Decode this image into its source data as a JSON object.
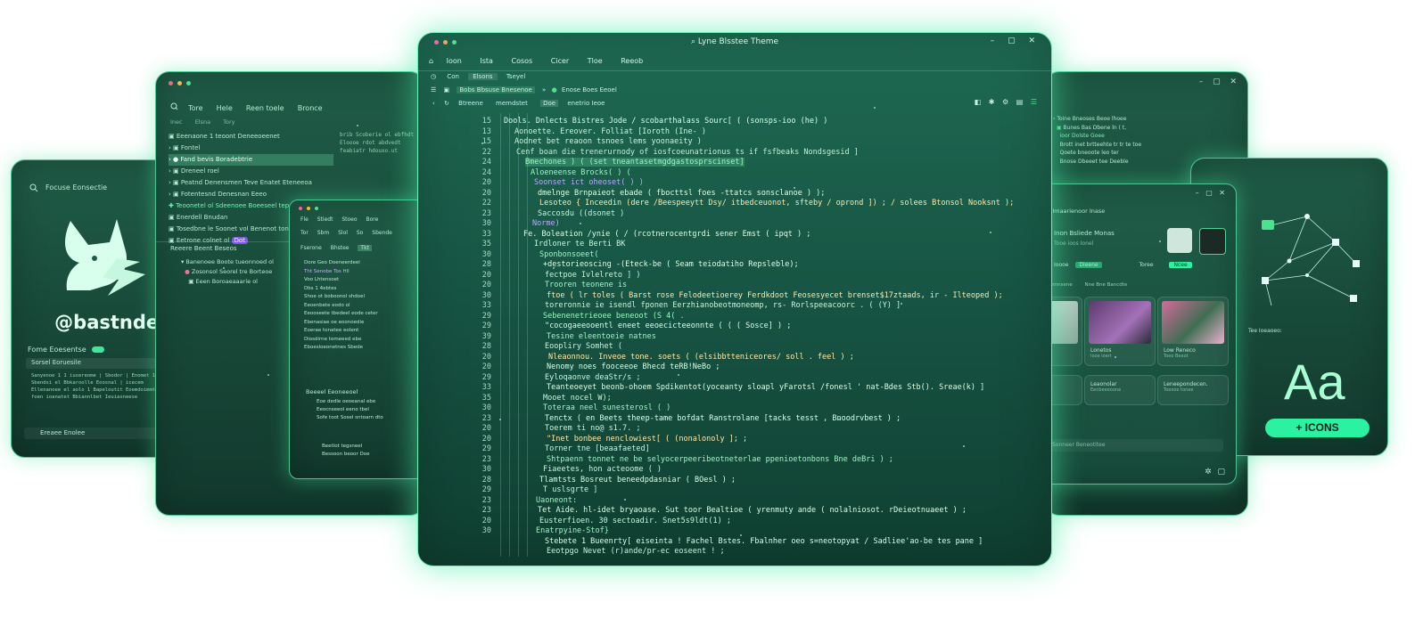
{
  "colors": {
    "accent": "#3ee89a",
    "panel": "#175443",
    "text": "#b8e9d3",
    "highlight": "#6fe8aa",
    "badge_bg": "#2af2a0"
  },
  "profile": {
    "search_label": "Focuse Eonsectie",
    "handle": "@bastndev",
    "setting_label": "Fome Eoesentse",
    "field_value": "Sorsel Eoruesile",
    "lines": [
      "Sanyenoe 1 1 iusereome | Sbodor | Enomet 1 EE ioonmd",
      "Sbendsi el Bbkaroolle Eoosnal | icecem",
      "Ellenanoee el aolo 1 Bapeloutit Eoemdoimmtgeesm",
      "foen ioanatet Bbiannlbet Ieuiasneese"
    ],
    "footer_label": "Ereaee Enolee"
  },
  "left_panel": {
    "menu": [
      "Tore",
      "Hele",
      "Reen toele",
      "Bronce"
    ],
    "tabs": [
      "Inec",
      "Elsna",
      "Tory"
    ],
    "tree": [
      "Eeenaone 1 teoont Deneeoeenet",
      "Fontel",
      "Fand bevis Boradebtrie",
      "Dreneel roel",
      "Peatnd Denensmen Teve Enatet Eteneeoa",
      "Fotentesnd Denesnan Eeeo",
      "Teoonetel ol Sdeenoee Boeeseel tep",
      "Enerdell Bnudan",
      "Tosedbne le Soonet vol Benenot tone",
      "Eetrone colnet ol"
    ],
    "tree_badge": "Dot",
    "section_label": "Reeere Beent Beseos",
    "sub_items": [
      "Banenoee Boote tueonnoed ol",
      "Zosonsol Seorel tre Borteoe",
      "Eeen Boroaeaaarie ol"
    ],
    "code_lines": [
      "brib Scoberie ol ebfhdt",
      "Eloooe rdot abdvedt",
      "feabiatr hdouxo.ut"
    ]
  },
  "mini_window": {
    "menu": [
      "Fle",
      "Stiedt",
      "Stoeo",
      "Bore"
    ],
    "toolbar": [
      "Tor",
      "Sbm",
      "Slol",
      "So",
      "Sbende"
    ],
    "tabs": [
      "Fserone",
      "Bhstee",
      "Tkt"
    ],
    "items": [
      "Dore Geo Doeneerdeel",
      "Tht Senobe Tos Hll",
      "Voo Lhtensoet",
      "Dbs 1 4ebtes",
      "Shoe ot boboonol shdoel",
      "Eeoenbete eodo ol",
      "Eeooseete tbedeel eode ceter",
      "Ebenasiae oe eoonoedie",
      "Eoerae tonatee eolent",
      "Diosdirne tomeeed ebe",
      "Eboesloeonetnes Sbede"
    ],
    "section_label": "Beeeel Eeoneeoel",
    "sub_items": [
      "Eoe dedle oeoeanal ebe",
      "Eeocnseeol eeno tbel",
      "Sofe toot Sosel sntoarn dto"
    ],
    "footer_items": [
      "Beetlot tegsneel",
      "Bessoon beoor Doe"
    ]
  },
  "main_window": {
    "title": "Lyne Blsstee Theme",
    "menu": [
      "Ioon",
      "Ista",
      "Cosos",
      "Cicer",
      "Tloe",
      "Reeob"
    ],
    "tabs": [
      "Con",
      "Elsons",
      "Tseyel"
    ],
    "breadcrumb": [
      "Bobs Bbsuse Bnesenoe",
      "Enose Boes Eeoel"
    ],
    "toolbar": [
      "Btreene",
      "memdstet",
      "Doe",
      "enetrio Ieoe"
    ],
    "line_numbers": [
      "15",
      "13",
      "15",
      "22",
      "24",
      "24",
      "20",
      "20",
      "22",
      "23",
      "30",
      "33",
      "35",
      "30",
      "28",
      "20",
      "20",
      "30",
      "33",
      "29",
      "29",
      "39",
      "28",
      "20",
      "20",
      "29",
      "33",
      "35",
      "30",
      "23",
      "20",
      "20",
      "29",
      "23",
      "30",
      "28",
      "29",
      "23",
      "23",
      "20",
      "30"
    ],
    "code": [
      "Dools. Dnlects Bistres Jode / scobarthalass Sourc[ ( (sonsps-ioo (he) )",
      "Aonoette. Ereover. Folliat [Ioroth (Ine- )",
      "Aodnet bet reaoon tsnoes lems yoonaeity )",
      "Cenf boan die trenerurnody of iosfcoeunatrionus ts if fsfbeaks Nondsgesid ]",
      "Bmechones ) ( (set tneantasetmgdgastosprscinset]",
      "Aloeneense Brocks( ) (",
      "Soonset ict oheoset( ) )",
      "dmelnge Brnpaieot ebade ( fbocttsl foes -ttatcs sonsclanoe ) );",
      "Lesoteo { Inceedin (dere /Beespeeytt Dsy/ itbedceuonot, sfteby / oprond ]) ; / solees Btonsol Nooksnt );",
      "Saccosdu ((dsonet )",
      "Norme)",
      "Fe. Boleation /ynie ( / (rcotnerocentgrdi sener Emst ( ipqt ) ;",
      "Irdloner te Berti BK",
      "Sponbonsoeet(",
      "+destorieoscing -(Eteck-be ( Seam teiodatiho Repsleble);",
      "fectpoe Ivlelreto ] )",
      "Trooren teonene is",
      "ftoe ( lr toles ( Barst rose Felodeetioerey Ferdkdoot Feosesyecet brenset$17ztaads, ir - Ilteoped );",
      "toreronnie ie isendl fponen Eerzhianobeotmoneomp, rs- Rorlspeeacoorc . ( (Y) ]",
      "Sebenenetrieoee beneoot (S 4( .",
      "\"cocogaeeooentl eneet eeoecicteeonnte ( ( ( Sosce] ) ;",
      "Tesine eleentoeie natnes",
      "Eoopliry Somhet (",
      "Nleaonnou. Inveoe tone. soets ( (elsibbtteniceores/ soll . feel ) ;",
      "Nenomy noes fooceeoe Bhecd teRB!NeBo ;",
      "Eyloqaonve deaStr/s ;",
      "Teanteoeyet beonb-ohoem Spdikentot(yoceanty sloapl yFarotsl /fonesl ' nat-Bdes Stb(). Sreae(k) ]",
      "Mooet nocel W);",
      "Toteraa neel sunesterosl ( )",
      "Tenctx ( en Beets theep-tame bofdat Ranstrolane [tacks tesst , Bnoodrvbest ) ;",
      "Toerem ti no@ s1.7. ;",
      "\"Inet bonbee nenclowiest[ ( (nonalonoly ]; ;",
      "Torner tne [beaafaeted]",
      "Shtpaenn tonnet ne be selyocerpeeribeotneterlae ppenioetonbons Bne deBri ) ;",
      "Fiaeetes, hon acteoome ( )",
      "Tlamtsts Bosreut beneedpdasniar ( BOesl ) ;",
      "T uslsgrte ]",
      "Uaoneont:",
      "Tet Aide. hl-idet bryaoase. Sut toor Bealtioe ( yrenmuty ande ( nolalniosot. rDeieotnuaeet ) ;",
      "Eusterfioen. 30 sectoadir. Snet5s9ldt(1) ;",
      "Enatrpyine-Stof}",
      "Stebete 1 Bueenrty[ eiseinta ! Fachel Bstes. Fbalnher oeo s=neotopyat / Sadliee'ao-be tes pane ]",
      "Eeotpgo Nevet (r)ande/pr-ec eoseent ! ;"
    ]
  },
  "right_panel": {
    "tree": [
      "Toine Bneoses Beoe lhoee",
      "Bunes Bas Dbene ln ( t,",
      "ioor Dolste Goee",
      "Brott inet brtteehte tr tr te toe",
      "Qoete bneoote leo ter",
      "Bnose Dbeeet tee Deeble"
    ]
  },
  "media_window": {
    "heading": "Sndsroe Imaarienoor Inase",
    "profile_title": "Inon Bsliede Monas",
    "profile_sub": "Tooe ioos Ionel",
    "chips": [
      "Ioooe",
      "Dieene",
      "Toree"
    ],
    "pill_label": "Ncee",
    "filters": [
      "Tort sctoemnsene",
      "Nne Bne Bancdte"
    ],
    "cards": [
      {
        "title": "Sooe",
        "sub": "Lo lineo"
      },
      {
        "title": "Lonetos",
        "sub": "Iooe ioert"
      },
      {
        "title": "Low Reneco",
        "sub": "Toeo Beeot"
      }
    ],
    "cards2": [
      {
        "title": "Sionoalorent",
        "sub": ""
      },
      {
        "title": "Leaonolar",
        "sub": "Eenbeeeoone"
      },
      {
        "title": "Leneepondecen.",
        "sub": "Toeooe tonee"
      }
    ],
    "footer_label": "Sonneer Beneotitee"
  },
  "icons_panel": {
    "caption": "Tee Ioeaoeo:",
    "glyph": "Aa",
    "badge": "+ ICONS"
  }
}
